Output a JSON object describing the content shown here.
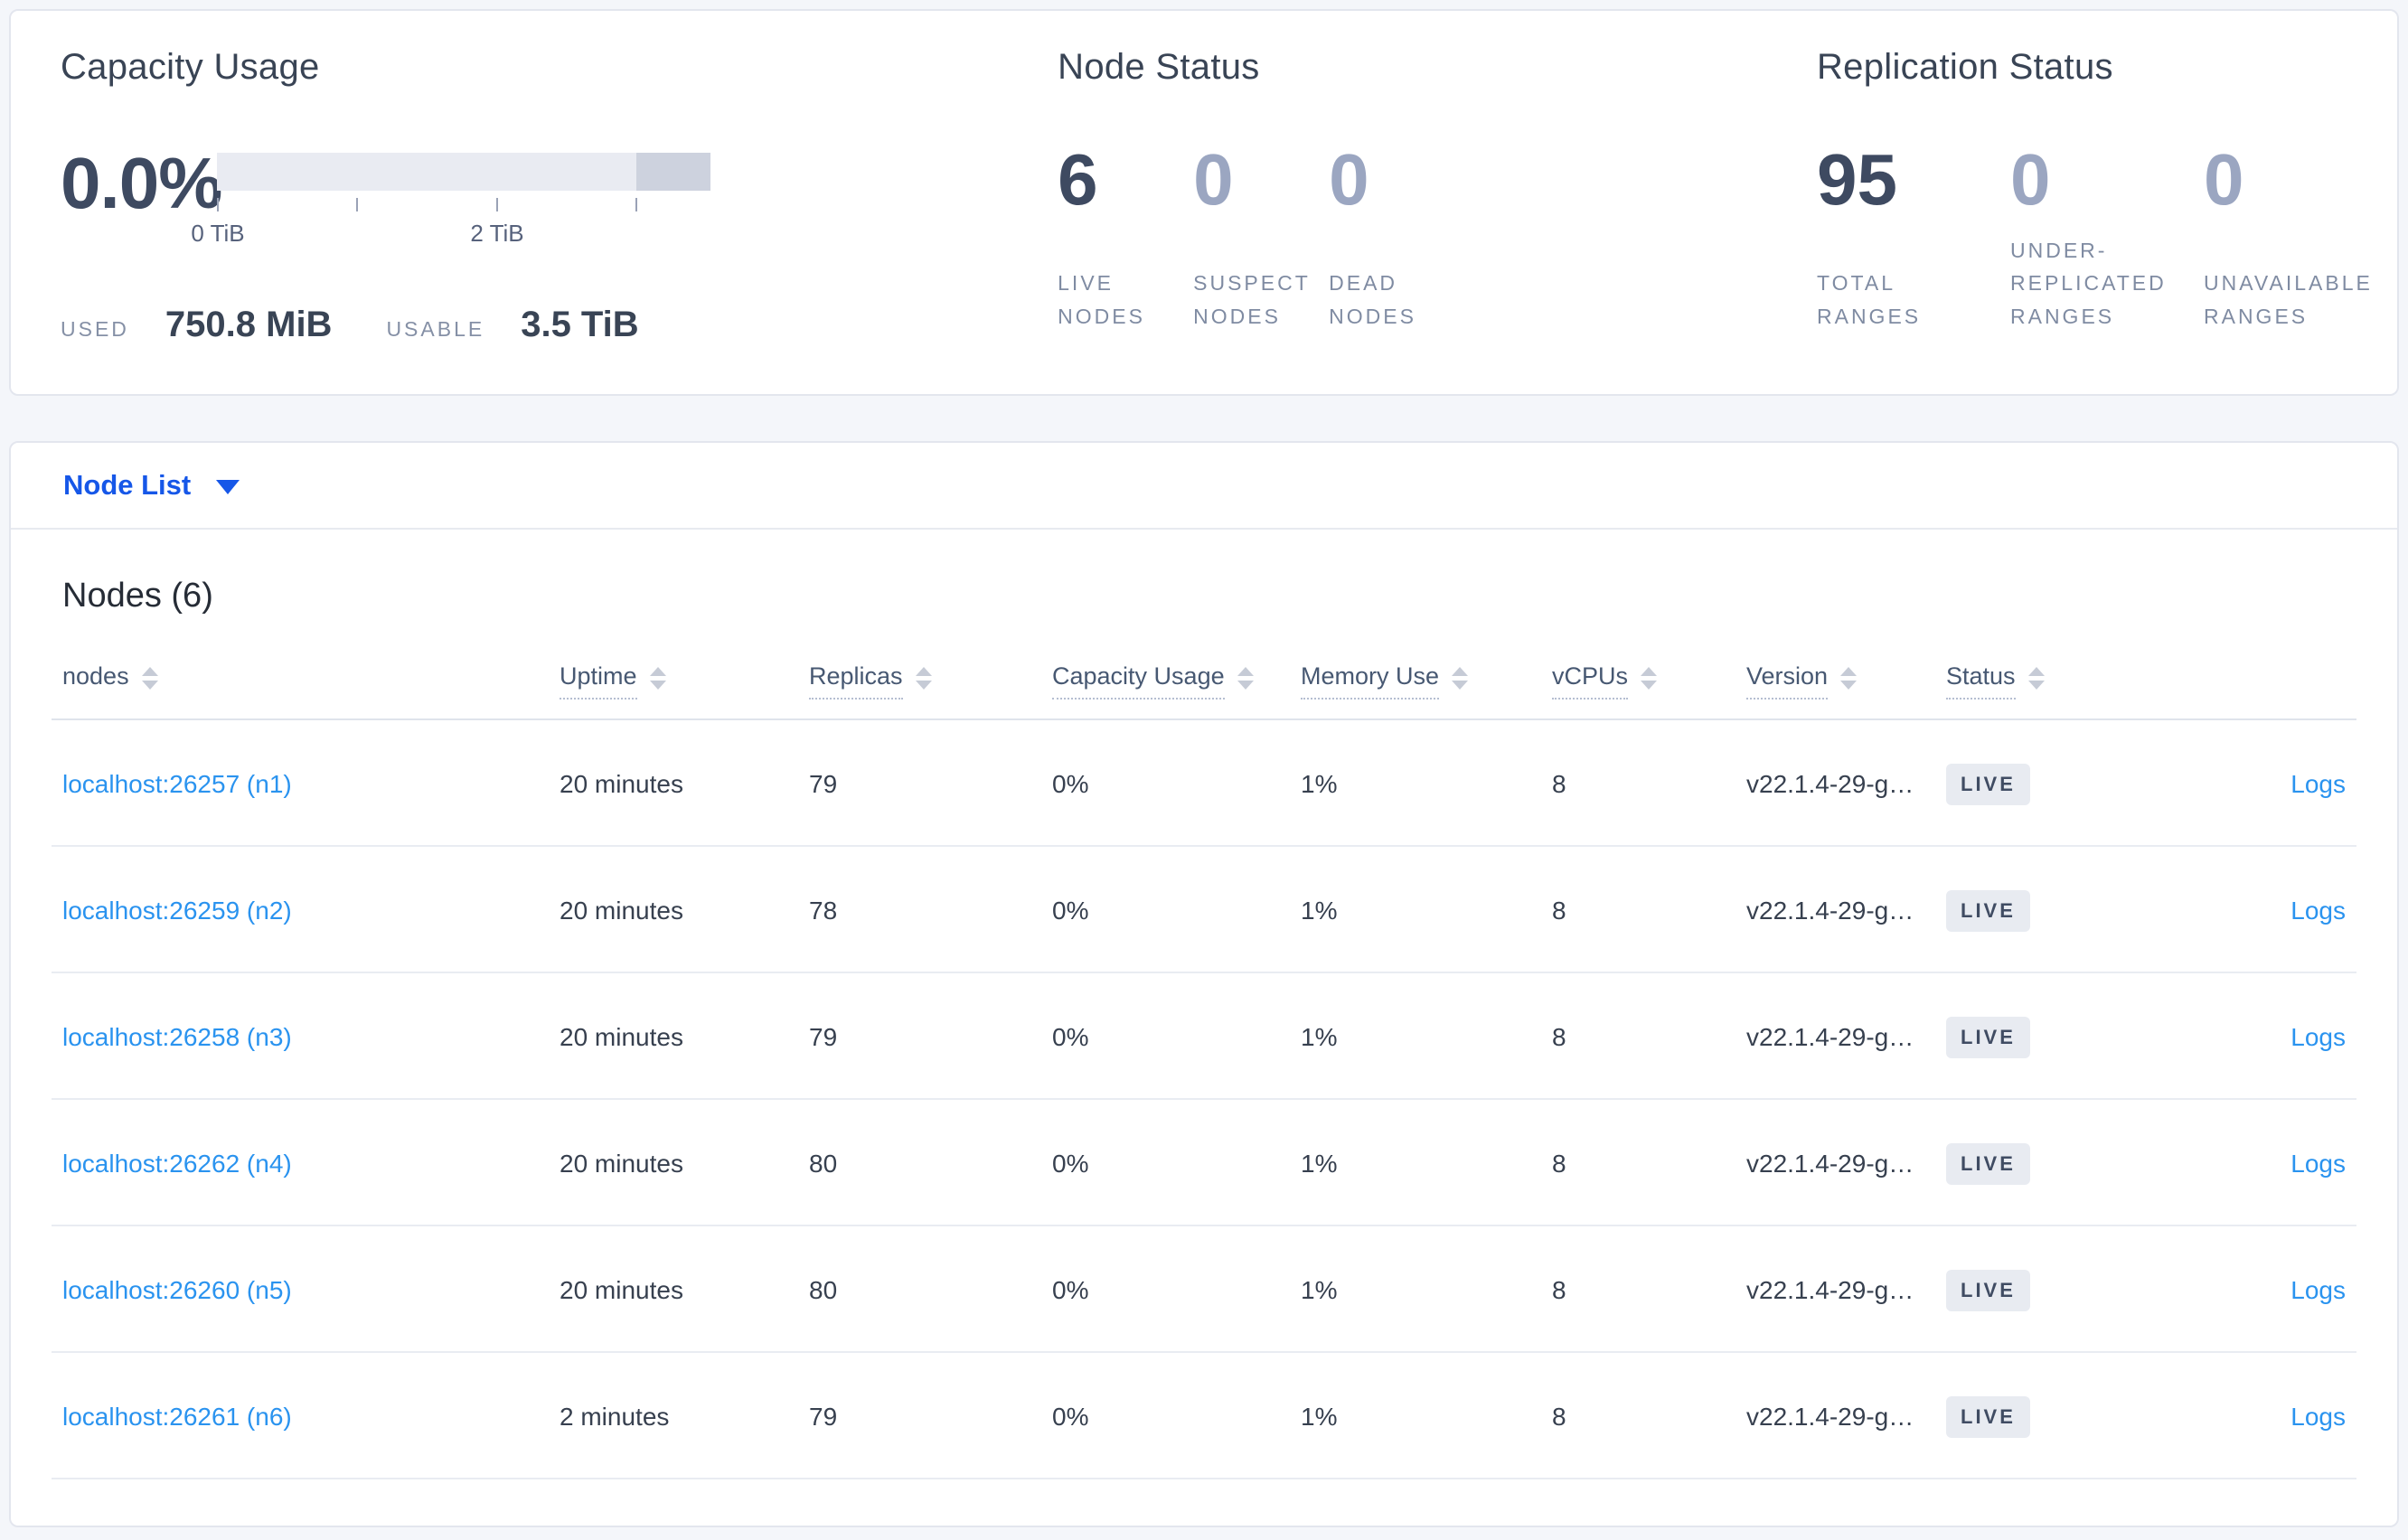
{
  "summary": {
    "capacity": {
      "title": "Capacity Usage",
      "percent": "0.0%",
      "axis_tick_labels": [
        "0 TiB",
        "2 TiB"
      ],
      "used_label": "USED",
      "used_value": "750.8 MiB",
      "usable_label": "USABLE",
      "usable_value": "3.5 TiB"
    },
    "node_status": {
      "title": "Node Status",
      "items": [
        {
          "value": "6",
          "label": "LIVE NODES"
        },
        {
          "value": "0",
          "label": "SUSPECT NODES"
        },
        {
          "value": "0",
          "label": "DEAD NODES"
        }
      ]
    },
    "replication_status": {
      "title": "Replication Status",
      "items": [
        {
          "value": "95",
          "label": "TOTAL RANGES"
        },
        {
          "value": "0",
          "label": "UNDER-REPLICATED RANGES"
        },
        {
          "value": "0",
          "label": "UNAVAILABLE RANGES"
        }
      ]
    }
  },
  "node_list_dropdown": {
    "label": "Node List"
  },
  "nodes_section": {
    "title": "Nodes (6)"
  },
  "table": {
    "headers": [
      "nodes",
      "Uptime",
      "Replicas",
      "Capacity Usage",
      "Memory Use",
      "vCPUs",
      "Version",
      "Status"
    ],
    "rows": [
      {
        "node": "localhost:26257 (n1)",
        "uptime": "20 minutes",
        "replicas": "79",
        "capacity": "0%",
        "memory": "1%",
        "vcpus": "8",
        "version": "v22.1.4-29-g…",
        "status": "LIVE",
        "logs": "Logs"
      },
      {
        "node": "localhost:26259 (n2)",
        "uptime": "20 minutes",
        "replicas": "78",
        "capacity": "0%",
        "memory": "1%",
        "vcpus": "8",
        "version": "v22.1.4-29-g…",
        "status": "LIVE",
        "logs": "Logs"
      },
      {
        "node": "localhost:26258 (n3)",
        "uptime": "20 minutes",
        "replicas": "79",
        "capacity": "0%",
        "memory": "1%",
        "vcpus": "8",
        "version": "v22.1.4-29-g…",
        "status": "LIVE",
        "logs": "Logs"
      },
      {
        "node": "localhost:26262 (n4)",
        "uptime": "20 minutes",
        "replicas": "80",
        "capacity": "0%",
        "memory": "1%",
        "vcpus": "8",
        "version": "v22.1.4-29-g…",
        "status": "LIVE",
        "logs": "Logs"
      },
      {
        "node": "localhost:26260 (n5)",
        "uptime": "20 minutes",
        "replicas": "80",
        "capacity": "0%",
        "memory": "1%",
        "vcpus": "8",
        "version": "v22.1.4-29-g…",
        "status": "LIVE",
        "logs": "Logs"
      },
      {
        "node": "localhost:26261 (n6)",
        "uptime": "2 minutes",
        "replicas": "79",
        "capacity": "0%",
        "memory": "1%",
        "vcpus": "8",
        "version": "v22.1.4-29-g…",
        "status": "LIVE",
        "logs": "Logs"
      }
    ]
  },
  "colors": {
    "page_background": "#f4f6fa",
    "panel_background": "#ffffff",
    "heading_slate": "#394455",
    "big_number_dark": "#3e4a61",
    "big_number_dim": "#9ba6c1",
    "caps_label_gray": "#7f8ba2",
    "dropdown_blue": "#1657e8",
    "link_blue": "#2a93ef",
    "capacity_bar_light": "#e9ebf2",
    "capacity_bar_dark": "#cdd2de",
    "badge_background": "#e8ebf1",
    "badge_text": "#404c63",
    "row_border": "#e9ecf2"
  }
}
